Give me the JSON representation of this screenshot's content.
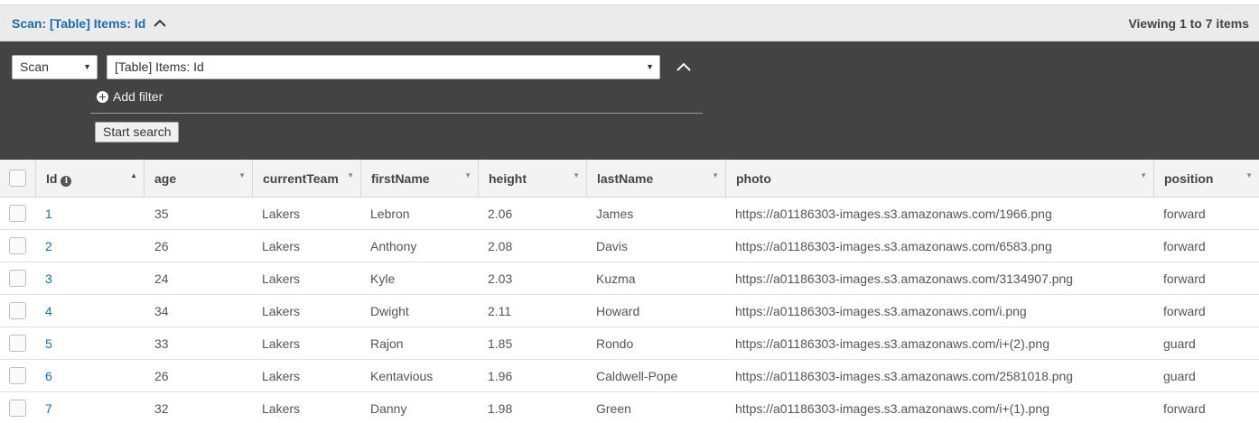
{
  "scan_header": {
    "title": "Scan: [Table] Items: Id",
    "viewing": "Viewing 1 to 7 items"
  },
  "query_panel": {
    "operation_select": "Scan",
    "target_select": "[Table] Items: Id",
    "add_filter_label": "Add filter",
    "start_search_label": "Start search"
  },
  "table": {
    "columns": [
      {
        "key": "id",
        "label": "Id"
      },
      {
        "key": "age",
        "label": "age"
      },
      {
        "key": "currentTeam",
        "label": "currentTeam"
      },
      {
        "key": "firstName",
        "label": "firstName"
      },
      {
        "key": "height",
        "label": "height"
      },
      {
        "key": "lastName",
        "label": "lastName"
      },
      {
        "key": "photo",
        "label": "photo"
      },
      {
        "key": "position",
        "label": "position"
      }
    ],
    "rows": [
      {
        "id": "1",
        "age": "35",
        "currentTeam": "Lakers",
        "firstName": "Lebron",
        "height": "2.06",
        "lastName": "James",
        "photo": "https://a01186303-images.s3.amazonaws.com/1966.png",
        "position": "forward"
      },
      {
        "id": "2",
        "age": "26",
        "currentTeam": "Lakers",
        "firstName": "Anthony",
        "height": "2.08",
        "lastName": "Davis",
        "photo": "https://a01186303-images.s3.amazonaws.com/6583.png",
        "position": "forward"
      },
      {
        "id": "3",
        "age": "24",
        "currentTeam": "Lakers",
        "firstName": "Kyle",
        "height": "2.03",
        "lastName": "Kuzma",
        "photo": "https://a01186303-images.s3.amazonaws.com/3134907.png",
        "position": "forward"
      },
      {
        "id": "4",
        "age": "34",
        "currentTeam": "Lakers",
        "firstName": "Dwight",
        "height": "2.11",
        "lastName": "Howard",
        "photo": "https://a01186303-images.s3.amazonaws.com/i.png",
        "position": "forward"
      },
      {
        "id": "5",
        "age": "33",
        "currentTeam": "Lakers",
        "firstName": "Rajon",
        "height": "1.85",
        "lastName": "Rondo",
        "photo": "https://a01186303-images.s3.amazonaws.com/i+(2).png",
        "position": "guard"
      },
      {
        "id": "6",
        "age": "26",
        "currentTeam": "Lakers",
        "firstName": "Kentavious",
        "height": "1.96",
        "lastName": "Caldwell-Pope",
        "photo": "https://a01186303-images.s3.amazonaws.com/2581018.png",
        "position": "guard"
      },
      {
        "id": "7",
        "age": "32",
        "currentTeam": "Lakers",
        "firstName": "Danny",
        "height": "1.98",
        "lastName": "Green",
        "photo": "https://a01186303-images.s3.amazonaws.com/i+(1).png",
        "position": "forward"
      }
    ]
  },
  "icons": {
    "collapse": "chevron-up-icon",
    "add_filter": "plus-circle-icon",
    "info": "info-icon",
    "sort": "sort-caret-icon"
  },
  "colors": {
    "link": "#1d6ba8",
    "panel": "#434343",
    "header_bg": "#ebebeb"
  }
}
